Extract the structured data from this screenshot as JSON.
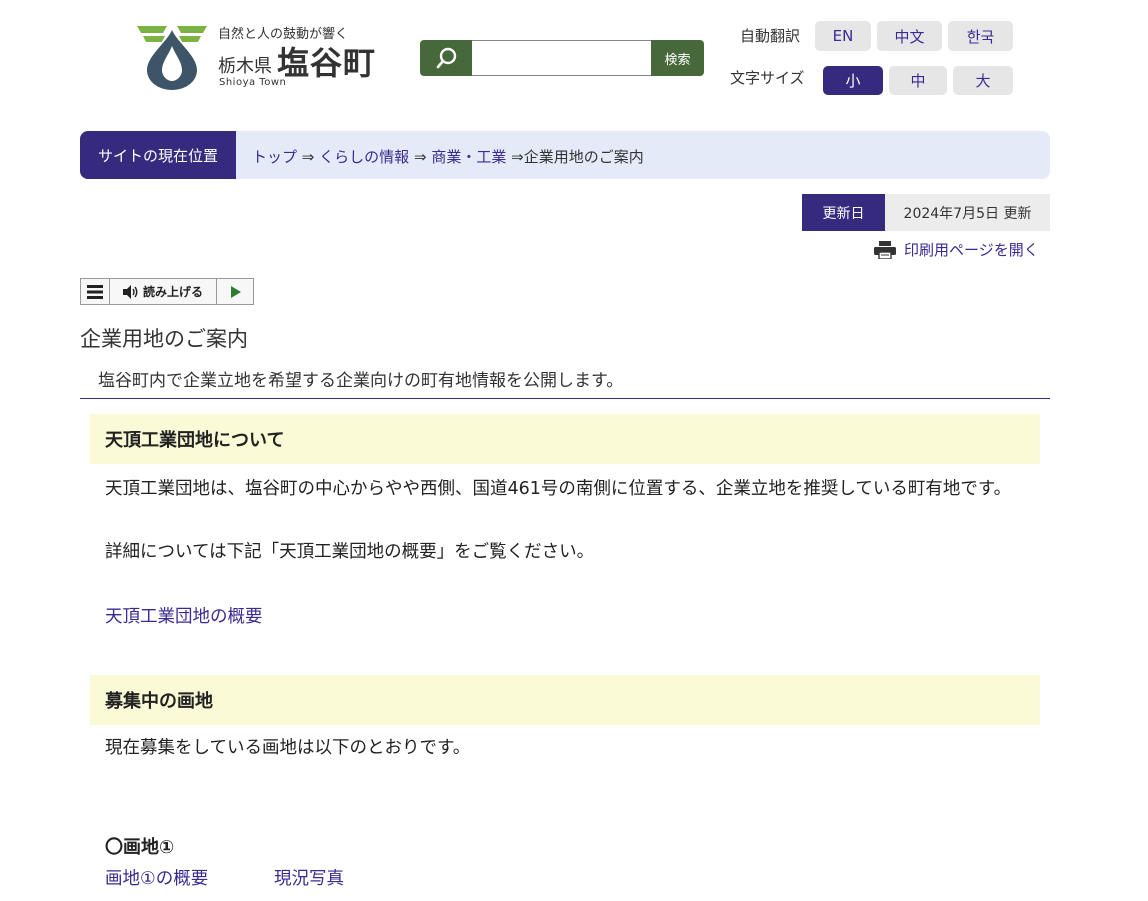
{
  "header": {
    "tagline": "自然と人の鼓動が響く",
    "prefecture": "栃木県",
    "town": "塩谷町",
    "town_en": "Shioya Town"
  },
  "search": {
    "button_label": "検索",
    "placeholder": ""
  },
  "translate": {
    "label": "自動翻訳",
    "options": [
      "EN",
      "中文",
      "한국"
    ]
  },
  "font_size": {
    "label": "文字サイズ",
    "options": [
      "小",
      "中",
      "大"
    ],
    "selected": "小"
  },
  "breadcrumb": {
    "label": "サイトの現在位置",
    "items": [
      "トップ",
      "くらしの情報",
      "商業・工業",
      "企業用地のご案内"
    ],
    "separator": "⇒"
  },
  "updated": {
    "label": "更新日",
    "date": "2024年7月5日 更新"
  },
  "print_link": "印刷用ページを開く",
  "readspeaker": {
    "label": "読み上げる"
  },
  "page": {
    "title": "企業用地のご案内",
    "lead": "塩谷町内で企業立地を希望する企業向けの町有地情報を公開します。"
  },
  "section1": {
    "heading": "天頂工業団地について",
    "para1": "天頂工業団地は、塩谷町の中心からやや西側、国道461号の南側に位置する、企業立地を推奨している町有地です。",
    "para2": "詳細については下記「天頂工業団地の概要」をご覧ください。",
    "link": "天頂工業団地の概要"
  },
  "section2": {
    "heading": "募集中の画地",
    "para": "現在募集をしている画地は以下のとおりです。",
    "lot_title": "〇画地①",
    "lot_links": [
      "画地①の概要",
      "現況写真"
    ]
  },
  "colors": {
    "accent": "#352a7e",
    "green": "#46683a",
    "breadcrumb_bg": "#e4eaf8",
    "section_bg": "#fafad6",
    "link": "#3a2b94"
  }
}
